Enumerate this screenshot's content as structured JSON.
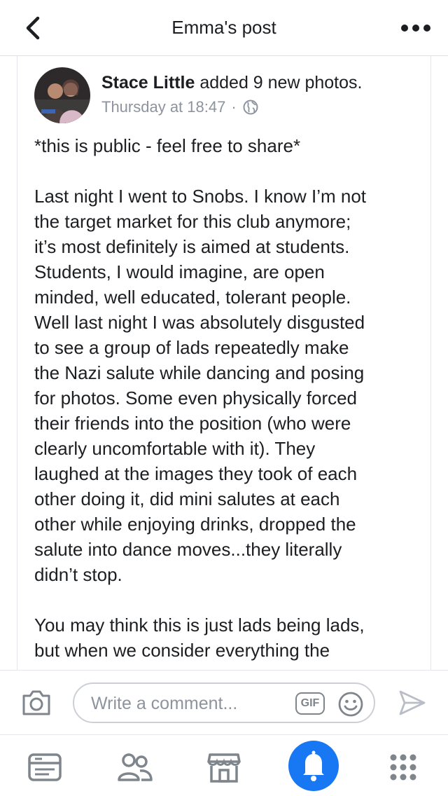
{
  "header": {
    "title": "Emma's post"
  },
  "post": {
    "author": "Stace Little",
    "action": "added 9 new photos.",
    "timestamp": "Thursday at 18:47",
    "separator": "·",
    "body_lines": [
      "*this is public - feel free to share*",
      "",
      "Last night I went to Snobs. I know I’m not",
      "the target market for this club anymore;",
      "it’s most definitely is aimed at students.",
      "Students, I would imagine, are open",
      "minded, well educated, tolerant people.",
      "Well last night I was absolutely disgusted",
      "to see a group of lads repeatedly make",
      "the Nazi salute while dancing and posing",
      "for photos. Some even physically forced",
      "their friends into the position  (who were",
      "clearly uncomfortable with it). They",
      "laughed at the images they took of each",
      "other doing it, did mini salutes at each",
      "other while enjoying drinks, dropped the",
      "salute into dance moves...they literally",
      "didn’t stop.",
      "",
      "You may think this is just lads being lads,",
      "but when we consider everything the"
    ]
  },
  "comment": {
    "placeholder": "Write a comment...",
    "gif_label": "GIF"
  },
  "tabbar": {
    "items": [
      {
        "icon": "news-feed-icon"
      },
      {
        "icon": "friends-icon"
      },
      {
        "icon": "marketplace-icon"
      },
      {
        "icon": "notifications-icon",
        "active": true
      },
      {
        "icon": "menu-grid-icon"
      }
    ]
  },
  "colors": {
    "accent": "#1877f2",
    "icon_gray": "#7f858c",
    "text": "#1c1e21",
    "meta": "#8d949e"
  }
}
